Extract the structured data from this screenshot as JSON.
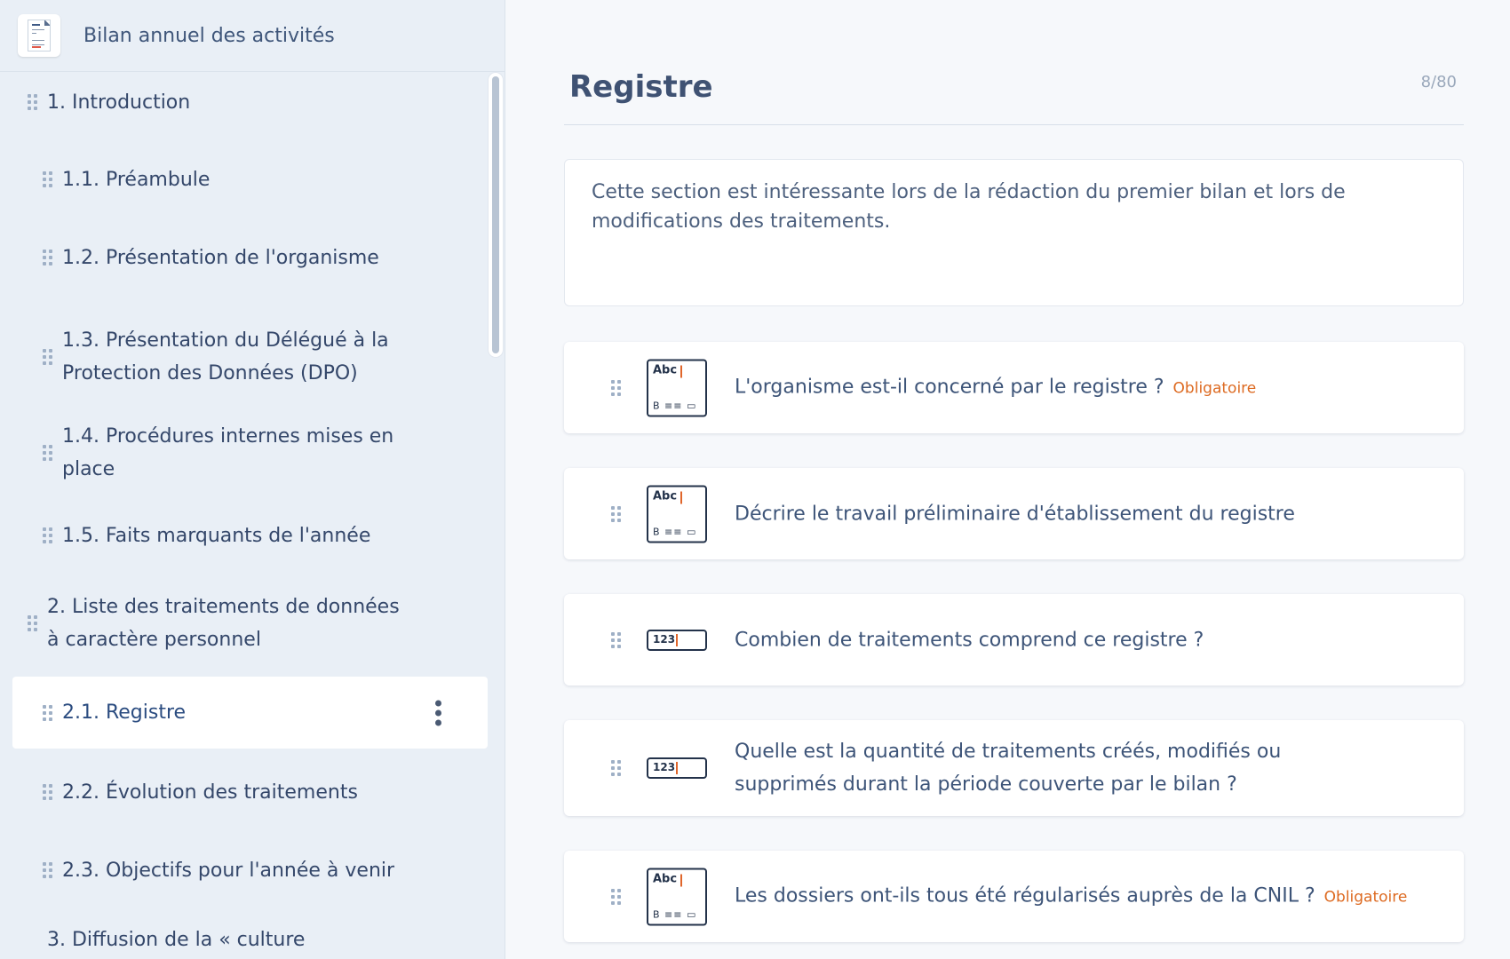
{
  "sidebar": {
    "title": "Bilan annuel des activités",
    "items": [
      {
        "label": "1. Introduction",
        "lines": [
          "1. Introduction"
        ]
      },
      {
        "label": "1.1. Préambule",
        "lines": [
          "1.1. Préambule"
        ]
      },
      {
        "label": "1.2. Présentation de l'organisme",
        "lines": [
          "1.2. Présentation de l'organisme"
        ]
      },
      {
        "label": "1.3. Présentation du Délégué à la Protection des Données (DPO)",
        "lines": [
          "1.3. Présentation du Délégué à la",
          "Protection des Données (DPO)"
        ]
      },
      {
        "label": "1.4. Procédures internes mises en place",
        "lines": [
          "1.4. Procédures internes mises en",
          "place"
        ]
      },
      {
        "label": "1.5. Faits marquants de l'année",
        "lines": [
          "1.5. Faits marquants de l'année"
        ]
      },
      {
        "label": "2. Liste des traitements de données à caractère personnel",
        "lines": [
          "2. Liste des traitements de données",
          "à caractère personnel"
        ]
      },
      {
        "label": "2.1. Registre",
        "lines": [
          "2.1. Registre"
        ]
      },
      {
        "label": "2.2. Évolution des traitements",
        "lines": [
          "2.2. Évolution des traitements"
        ]
      },
      {
        "label": "2.3. Objectifs pour l'année à venir",
        "lines": [
          "2.3. Objectifs pour l'année à venir"
        ]
      },
      {
        "label": "3. Diffusion de la « culture",
        "lines": [
          "3. Diffusion de la « culture"
        ]
      }
    ]
  },
  "main": {
    "title": "Registre",
    "counter": "8/80",
    "description": "Cette section est intéressante lors de la rédaction du premier bilan et lors de modifications des traitements.",
    "questions": [
      {
        "type": "text",
        "label": "L'organisme est-il concerné par le registre ?",
        "badge": "Obligatoire"
      },
      {
        "type": "text",
        "label": "Décrire le travail préliminaire d'établissement du registre",
        "badge": ""
      },
      {
        "type": "number",
        "label": "Combien de traitements comprend ce registre ?",
        "badge": ""
      },
      {
        "type": "number",
        "label": "Quelle est la quantité de traitements créés, modifiés ou supprimés durant la période couverte par le bilan ?",
        "badge": ""
      },
      {
        "type": "text",
        "label": "Les dossiers ont-ils tous été régularisés auprès de la CNIL ?",
        "badge": "Obligatoire"
      }
    ],
    "icon_text": {
      "abc": "Abc",
      "toolbar": "B ≡≡ ▭"
    },
    "icon_number": {
      "num": "123"
    }
  },
  "colors": {
    "accent_orange": "#dd6a21",
    "text_primary": "#3d5478",
    "sidebar_bg": "#e9eff6",
    "active_item_text": "#2b4c80"
  }
}
